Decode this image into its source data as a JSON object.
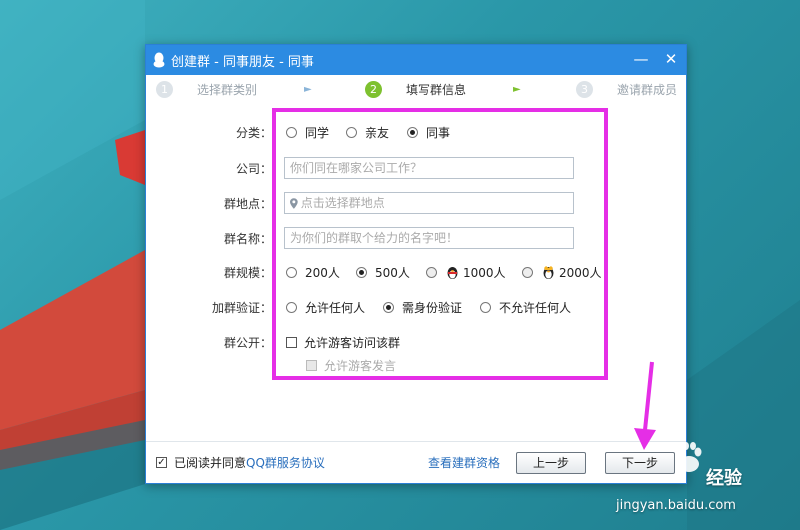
{
  "window": {
    "title": "创建群 - 同事朋友 - 同事",
    "minimize": "—",
    "close": "✕"
  },
  "steps": [
    {
      "num": "1",
      "label": "选择群类别"
    },
    {
      "num": "2",
      "label": "填写群信息"
    },
    {
      "num": "3",
      "label": "邀请群成员"
    }
  ],
  "form": {
    "category": {
      "label": "分类：",
      "options": [
        "同学",
        "亲友",
        "同事"
      ],
      "selected": "同事"
    },
    "company": {
      "label": "公司：",
      "placeholder": "你们同在哪家公司工作？"
    },
    "location": {
      "label": "群地点：",
      "placeholder": "点击选择群地点"
    },
    "group_name": {
      "label": "群名称：",
      "placeholder": "为你们的群取个给力的名字吧！"
    },
    "group_size": {
      "label": "群规模：",
      "options": [
        "200人",
        "500人",
        "1000人",
        "2000人"
      ],
      "selected": "500人"
    },
    "verification": {
      "label": "加群验证：",
      "options": [
        "允许任何人",
        "需身份验证",
        "不允许任何人"
      ],
      "selected": "需身份验证"
    },
    "public": {
      "label": "群公开：",
      "allow_visitor_access": "允许游客访问该群",
      "allow_visitor_speak": "允许游客发言"
    }
  },
  "footer": {
    "agree_prefix": "已阅读并同意",
    "agree_link": "QQ群服务协议",
    "agreed": true,
    "view_qualification": "查看建群资格",
    "prev": "上一步",
    "next": "下一步"
  },
  "watermark": {
    "brand": "经验",
    "url": "jingyan.baidu.com"
  },
  "colors": {
    "titlebar": "#2c8be2",
    "active_step": "#7ec12f",
    "highlight": "#e52ee6",
    "link": "#2a6fbd"
  }
}
